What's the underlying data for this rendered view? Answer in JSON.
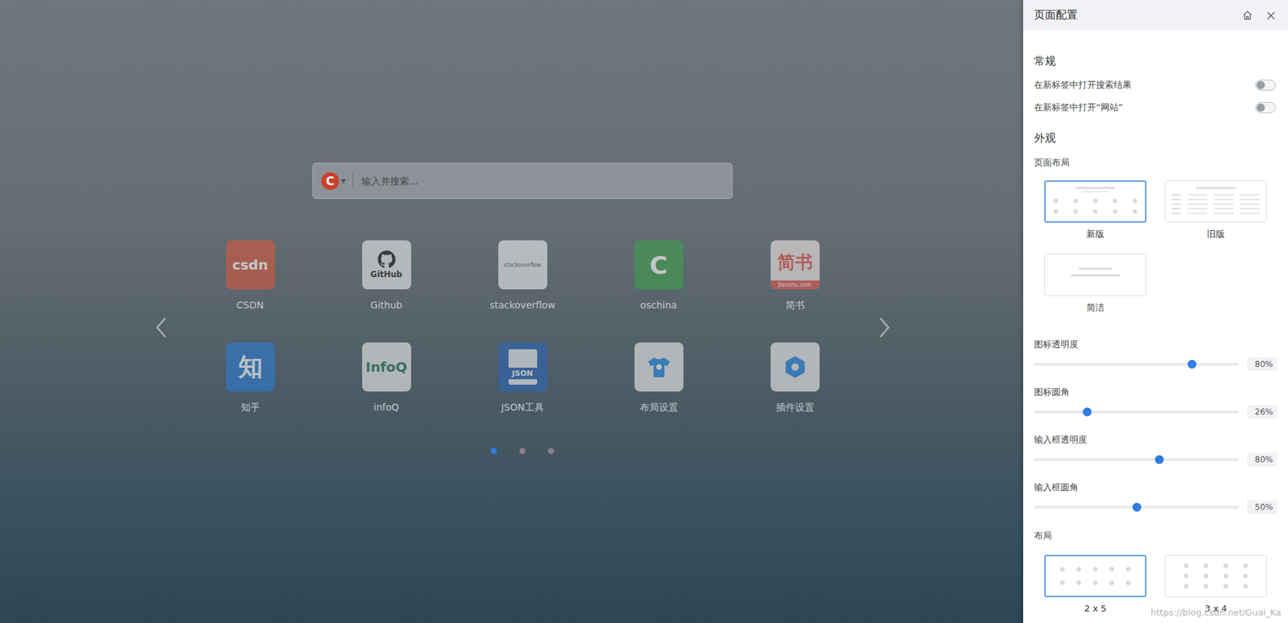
{
  "search": {
    "engine_logo": "C",
    "engine_caret": "▼",
    "placeholder": "输入并搜索..."
  },
  "shortcuts": [
    {
      "label": "CSDN",
      "kind": "text",
      "logo_text": "csdn",
      "color": "#d4583d",
      "ink": "#ffffff"
    },
    {
      "label": "Github",
      "kind": "github",
      "logo_text": "GitHub",
      "color": "#e9e9e9",
      "ink": "#222222"
    },
    {
      "label": "stackoverflow",
      "kind": "small",
      "logo_text": "stackoverflow",
      "color": "#ececec",
      "ink": "#555555"
    },
    {
      "label": "oschina",
      "kind": "big",
      "logo_text": "C",
      "color": "#3f9d4c",
      "ink": "#ffffff"
    },
    {
      "label": "简书",
      "kind": "jianshu",
      "logo_text": "简书",
      "logo_sub": "Jianshu.com",
      "color": "#efe6e3",
      "ink": "#e0574f"
    },
    {
      "label": "知乎",
      "kind": "big",
      "logo_text": "知",
      "color": "#2c7bd1",
      "ink": "#ffffff"
    },
    {
      "label": "infoQ",
      "kind": "text",
      "logo_text": "InfoQ",
      "color": "#ececec",
      "ink": "#2d7a5a"
    },
    {
      "label": "JSON工具",
      "kind": "json",
      "logo_text": "JSON",
      "color": "#2f66b4",
      "ink": "#ffffff"
    },
    {
      "label": "布局设置",
      "kind": "shirt",
      "color": "#ececec",
      "ink": "#2f8de4"
    },
    {
      "label": "插件设置",
      "kind": "hex",
      "color": "#ececec",
      "ink": "#2f8de4"
    }
  ],
  "pager": {
    "pages": [
      {
        "selected": true
      },
      {
        "selected": false
      },
      {
        "selected": false
      }
    ]
  },
  "panel": {
    "title": "页面配置",
    "general": {
      "title": "常规",
      "toggles": [
        {
          "label": "在新标签中打开搜索结果",
          "on": false
        },
        {
          "label": "在新标签中打开“网站”",
          "on": false
        }
      ]
    },
    "appearance": {
      "title": "外观",
      "layout_title": "页面布局",
      "layouts": [
        {
          "label": "新版",
          "kind": "new",
          "selected": true
        },
        {
          "label": "旧版",
          "kind": "old",
          "selected": false
        },
        {
          "label": "简洁",
          "kind": "simple",
          "selected": false
        }
      ],
      "sliders": [
        {
          "label": "图标透明度",
          "level": 0.77,
          "reading": "80%"
        },
        {
          "label": "图标圆角",
          "level": 0.26,
          "reading": "26%"
        },
        {
          "label": "输入框透明度",
          "level": 0.61,
          "reading": "80%"
        },
        {
          "label": "输入框圆角",
          "level": 0.5,
          "reading": "50%"
        }
      ],
      "grid_title": "布局",
      "grids": [
        {
          "label": "2 x 5",
          "kind": "wide",
          "selected": true
        },
        {
          "label": "3 x 4",
          "kind": "tall",
          "selected": false
        }
      ]
    }
  },
  "watermark": "https://blog.csdn.net/Guai_Ka"
}
